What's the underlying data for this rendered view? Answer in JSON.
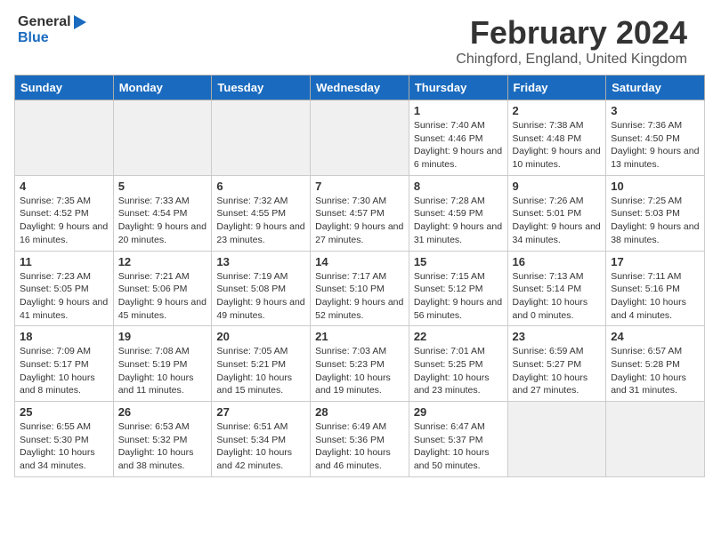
{
  "header": {
    "logo": {
      "general": "General",
      "blue": "Blue",
      "arrow": "arrow"
    },
    "title": "February 2024",
    "location": "Chingford, England, United Kingdom"
  },
  "calendar": {
    "days_of_week": [
      "Sunday",
      "Monday",
      "Tuesday",
      "Wednesday",
      "Thursday",
      "Friday",
      "Saturday"
    ],
    "weeks": [
      [
        {
          "day": "",
          "info": ""
        },
        {
          "day": "",
          "info": ""
        },
        {
          "day": "",
          "info": ""
        },
        {
          "day": "",
          "info": ""
        },
        {
          "day": "1",
          "info": "Sunrise: 7:40 AM\nSunset: 4:46 PM\nDaylight: 9 hours\nand 6 minutes."
        },
        {
          "day": "2",
          "info": "Sunrise: 7:38 AM\nSunset: 4:48 PM\nDaylight: 9 hours\nand 10 minutes."
        },
        {
          "day": "3",
          "info": "Sunrise: 7:36 AM\nSunset: 4:50 PM\nDaylight: 9 hours\nand 13 minutes."
        }
      ],
      [
        {
          "day": "4",
          "info": "Sunrise: 7:35 AM\nSunset: 4:52 PM\nDaylight: 9 hours\nand 16 minutes."
        },
        {
          "day": "5",
          "info": "Sunrise: 7:33 AM\nSunset: 4:54 PM\nDaylight: 9 hours\nand 20 minutes."
        },
        {
          "day": "6",
          "info": "Sunrise: 7:32 AM\nSunset: 4:55 PM\nDaylight: 9 hours\nand 23 minutes."
        },
        {
          "day": "7",
          "info": "Sunrise: 7:30 AM\nSunset: 4:57 PM\nDaylight: 9 hours\nand 27 minutes."
        },
        {
          "day": "8",
          "info": "Sunrise: 7:28 AM\nSunset: 4:59 PM\nDaylight: 9 hours\nand 31 minutes."
        },
        {
          "day": "9",
          "info": "Sunrise: 7:26 AM\nSunset: 5:01 PM\nDaylight: 9 hours\nand 34 minutes."
        },
        {
          "day": "10",
          "info": "Sunrise: 7:25 AM\nSunset: 5:03 PM\nDaylight: 9 hours\nand 38 minutes."
        }
      ],
      [
        {
          "day": "11",
          "info": "Sunrise: 7:23 AM\nSunset: 5:05 PM\nDaylight: 9 hours\nand 41 minutes."
        },
        {
          "day": "12",
          "info": "Sunrise: 7:21 AM\nSunset: 5:06 PM\nDaylight: 9 hours\nand 45 minutes."
        },
        {
          "day": "13",
          "info": "Sunrise: 7:19 AM\nSunset: 5:08 PM\nDaylight: 9 hours\nand 49 minutes."
        },
        {
          "day": "14",
          "info": "Sunrise: 7:17 AM\nSunset: 5:10 PM\nDaylight: 9 hours\nand 52 minutes."
        },
        {
          "day": "15",
          "info": "Sunrise: 7:15 AM\nSunset: 5:12 PM\nDaylight: 9 hours\nand 56 minutes."
        },
        {
          "day": "16",
          "info": "Sunrise: 7:13 AM\nSunset: 5:14 PM\nDaylight: 10 hours\nand 0 minutes."
        },
        {
          "day": "17",
          "info": "Sunrise: 7:11 AM\nSunset: 5:16 PM\nDaylight: 10 hours\nand 4 minutes."
        }
      ],
      [
        {
          "day": "18",
          "info": "Sunrise: 7:09 AM\nSunset: 5:17 PM\nDaylight: 10 hours\nand 8 minutes."
        },
        {
          "day": "19",
          "info": "Sunrise: 7:08 AM\nSunset: 5:19 PM\nDaylight: 10 hours\nand 11 minutes."
        },
        {
          "day": "20",
          "info": "Sunrise: 7:05 AM\nSunset: 5:21 PM\nDaylight: 10 hours\nand 15 minutes."
        },
        {
          "day": "21",
          "info": "Sunrise: 7:03 AM\nSunset: 5:23 PM\nDaylight: 10 hours\nand 19 minutes."
        },
        {
          "day": "22",
          "info": "Sunrise: 7:01 AM\nSunset: 5:25 PM\nDaylight: 10 hours\nand 23 minutes."
        },
        {
          "day": "23",
          "info": "Sunrise: 6:59 AM\nSunset: 5:27 PM\nDaylight: 10 hours\nand 27 minutes."
        },
        {
          "day": "24",
          "info": "Sunrise: 6:57 AM\nSunset: 5:28 PM\nDaylight: 10 hours\nand 31 minutes."
        }
      ],
      [
        {
          "day": "25",
          "info": "Sunrise: 6:55 AM\nSunset: 5:30 PM\nDaylight: 10 hours\nand 34 minutes."
        },
        {
          "day": "26",
          "info": "Sunrise: 6:53 AM\nSunset: 5:32 PM\nDaylight: 10 hours\nand 38 minutes."
        },
        {
          "day": "27",
          "info": "Sunrise: 6:51 AM\nSunset: 5:34 PM\nDaylight: 10 hours\nand 42 minutes."
        },
        {
          "day": "28",
          "info": "Sunrise: 6:49 AM\nSunset: 5:36 PM\nDaylight: 10 hours\nand 46 minutes."
        },
        {
          "day": "29",
          "info": "Sunrise: 6:47 AM\nSunset: 5:37 PM\nDaylight: 10 hours\nand 50 minutes."
        },
        {
          "day": "",
          "info": ""
        },
        {
          "day": "",
          "info": ""
        }
      ]
    ]
  }
}
